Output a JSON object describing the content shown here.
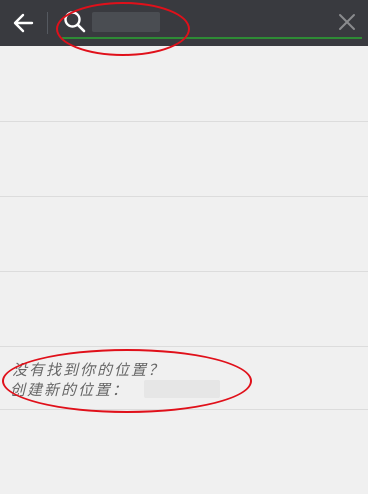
{
  "header": {
    "back_icon": "arrow-left-icon",
    "search_icon": "search-icon",
    "clear_icon": "close-icon",
    "search": {
      "value": "",
      "placeholder": ""
    },
    "underline_color": "#2e8b35"
  },
  "results": [
    {
      "label": ""
    },
    {
      "label": ""
    },
    {
      "label": ""
    },
    {
      "label": ""
    }
  ],
  "not_found": {
    "line1": "没有找到你的位置？",
    "line2": "创建新的位置："
  },
  "colors": {
    "header_bg": "#393a3f",
    "page_bg": "#f0f0f0",
    "annotation": "#e0101a"
  }
}
